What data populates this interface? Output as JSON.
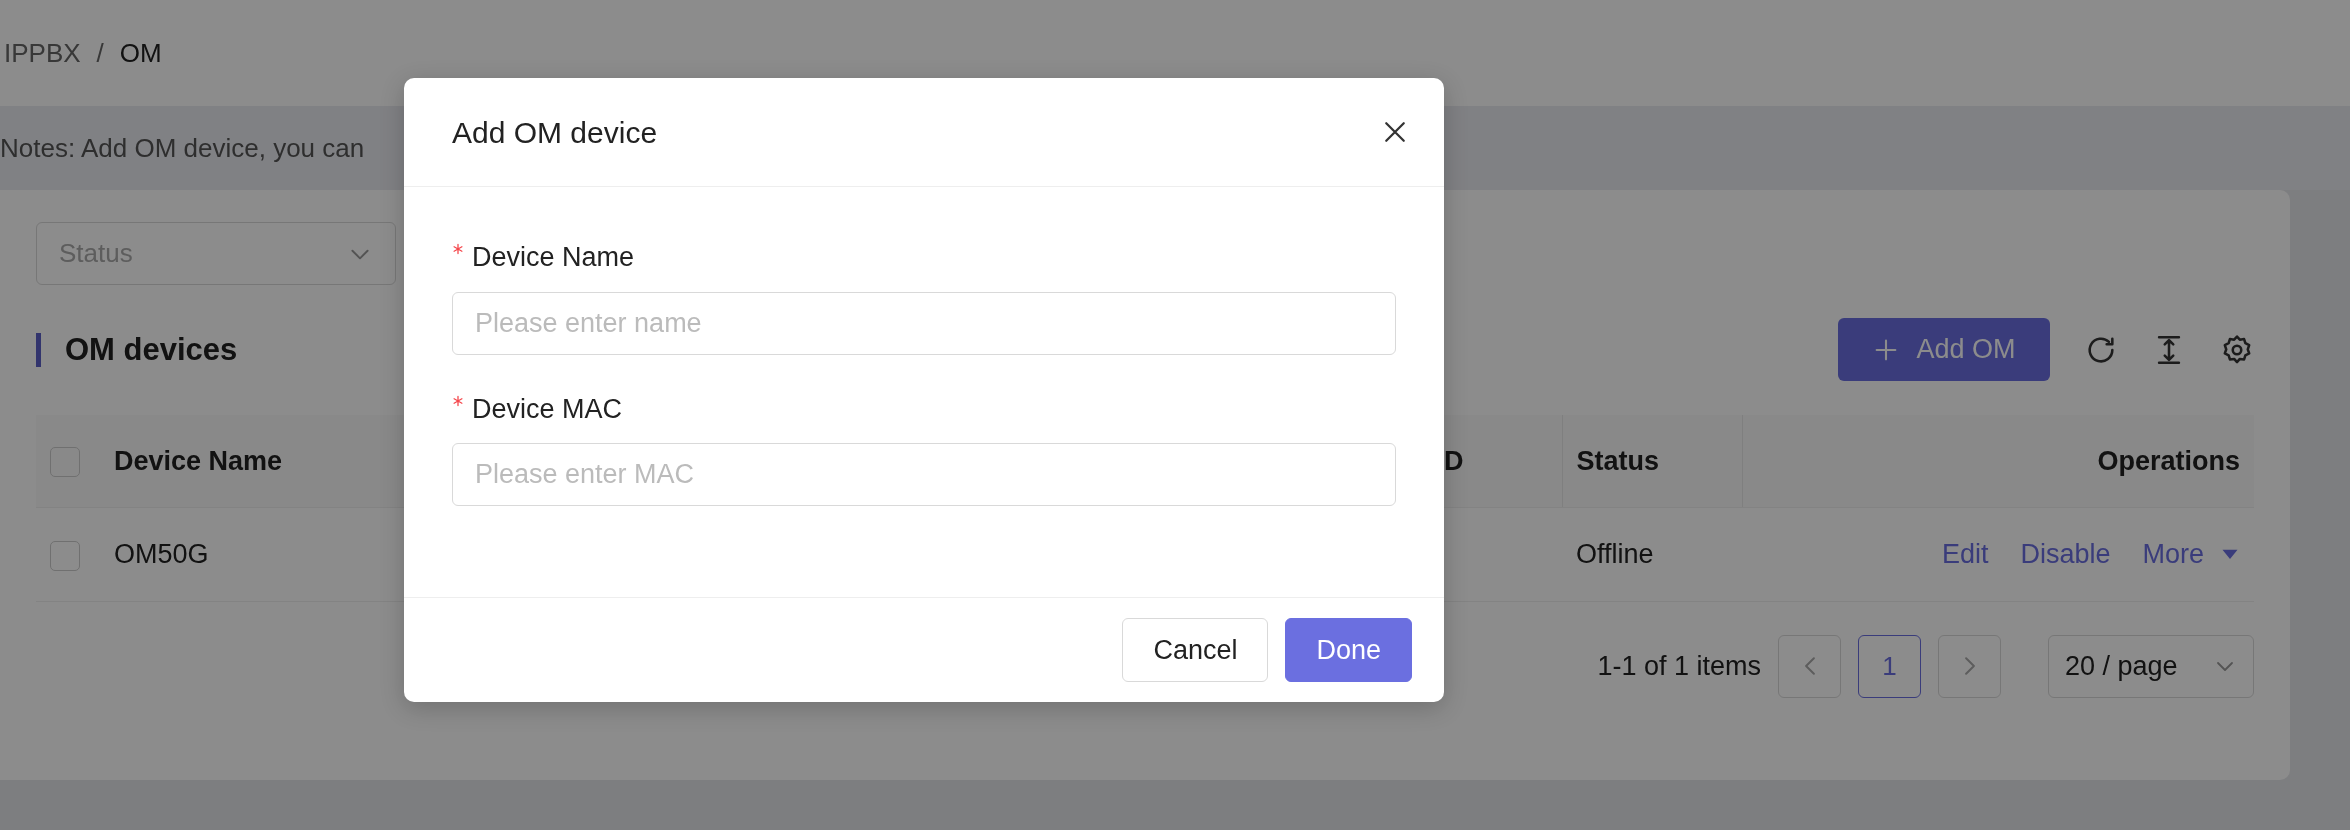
{
  "breadcrumb": {
    "items": [
      "IPPBX",
      "OM"
    ],
    "separator": "/"
  },
  "notes": "Notes: Add OM device, you can",
  "filter": {
    "placeholder": "Status"
  },
  "section_title": "OM devices",
  "add_button": {
    "label": "Add OM"
  },
  "table": {
    "select_all_checked": false,
    "columns": [
      {
        "label": "Device Name"
      },
      {
        "label": "D"
      },
      {
        "label": "Status"
      },
      {
        "label": "Operations"
      }
    ],
    "rows": [
      {
        "checked": false,
        "device_name": "OM50G",
        "status": "Offline",
        "actions": [
          "Edit",
          "Disable",
          "More"
        ]
      }
    ]
  },
  "pagination": {
    "summary": "1-1 of 1 items",
    "pages": [
      {
        "label": "1",
        "selected": true
      }
    ],
    "page_size": "20 / page"
  },
  "modal": {
    "title": "Add OM device",
    "fields": [
      {
        "label": "Device Name",
        "required": true,
        "placeholder": "Please enter name"
      },
      {
        "label": "Device MAC",
        "required": true,
        "placeholder": "Please enter MAC"
      }
    ],
    "buttons": [
      {
        "label": "Cancel",
        "kind": "default"
      },
      {
        "label": "Done",
        "kind": "primary"
      }
    ]
  }
}
